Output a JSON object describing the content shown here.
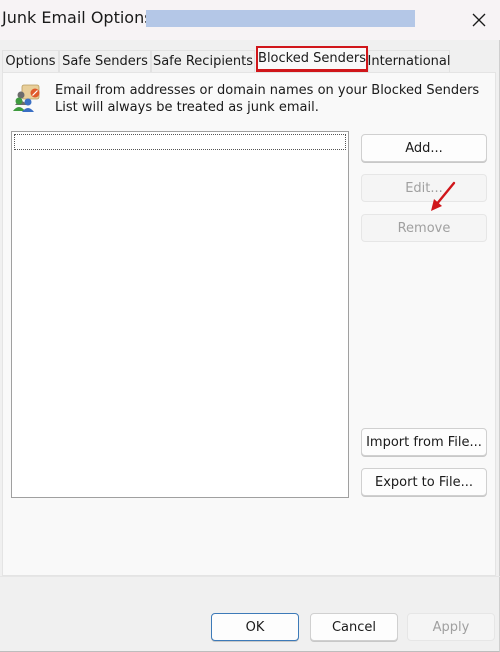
{
  "window": {
    "title": "Junk Email Options - ",
    "close_icon": "close-icon"
  },
  "tabs": [
    {
      "label": "Options",
      "active": false
    },
    {
      "label": "Safe Senders",
      "active": false
    },
    {
      "label": "Safe Recipients",
      "active": false
    },
    {
      "label": "Blocked Senders",
      "active": true
    },
    {
      "label": "International",
      "active": false
    }
  ],
  "panel": {
    "info_icon": "blocked-senders-icon",
    "info_text": "Email from addresses or domain names on your Blocked Senders List will always be treated as junk email.",
    "list_items": [],
    "buttons": {
      "add": "Add...",
      "edit": "Edit...",
      "remove": "Remove",
      "import": "Import from File...",
      "export": "Export to File..."
    }
  },
  "footer": {
    "ok": "OK",
    "cancel": "Cancel",
    "apply": "Apply"
  },
  "colors": {
    "highlight": "#d0161a",
    "redacted": "#b4c7e7",
    "default_button_border": "#3d7ab8"
  }
}
